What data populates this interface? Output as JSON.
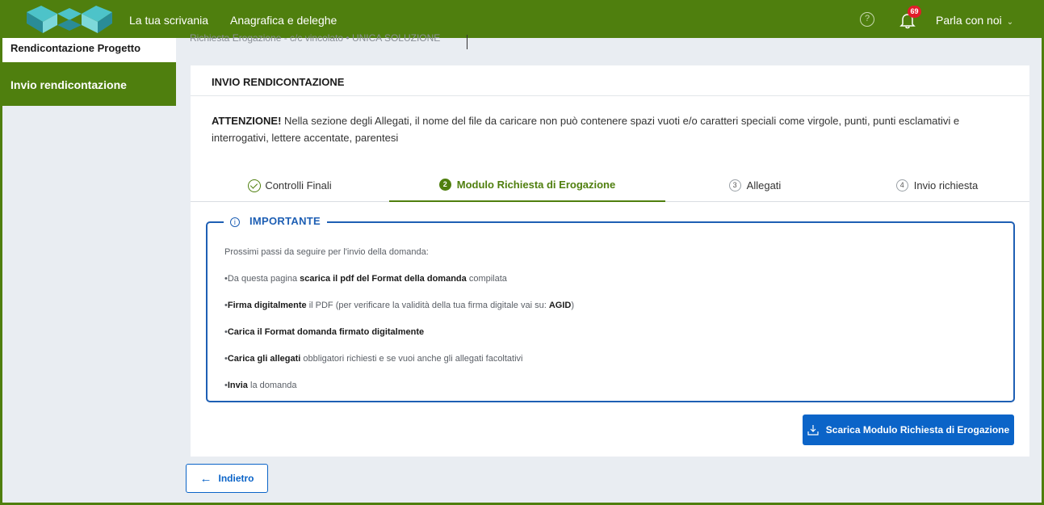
{
  "header": {
    "nav": [
      "La tua scrivania",
      "Anagrafica e deleghe"
    ],
    "help_icon": "question-circle-icon",
    "notifications_count": "69",
    "talk_label": "Parla con noi",
    "chevron": "⌄",
    "accent_color": "#4f7f0e"
  },
  "sidebar": {
    "title": "Rendicontazione Progetto",
    "active_item": "Invio rendicontazione"
  },
  "breadcrumb": {
    "text": "Richiesta Erogazione - c/c vincolato   •   UNICA SOLUZIONE"
  },
  "card": {
    "title": "INVIO RENDICONTAZIONE",
    "warning_strong": "ATTENZIONE!",
    "warning_text": " Nella sezione degli Allegati, il nome del file da caricare non può contenere spazi vuoti e/o caratteri speciali come virgole, punti, punti esclamativi e interrogativi, lettere accentate, parentesi"
  },
  "steps": [
    {
      "num": "",
      "label": "Controlli Finali",
      "state": "done"
    },
    {
      "num": "2",
      "label": "Modulo Richiesta di Erogazione",
      "state": "active"
    },
    {
      "num": "3",
      "label": "Allegati",
      "state": "todo"
    },
    {
      "num": "4",
      "label": "Invio richiesta",
      "state": "todo"
    }
  ],
  "important": {
    "title": "IMPORTANTE",
    "intro": "Prossimi passi da seguire per l'invio della domanda:",
    "items": [
      {
        "pre": "•Da questa pagina ",
        "bold": "scarica il pdf del Format della domanda",
        "post": " compilata"
      },
      {
        "pre": "•",
        "bold": "Firma digitalmente",
        "post": " il PDF (per verificare la validità della tua firma digitale vai su: ",
        "bold2": "AGID",
        "post2": ")"
      },
      {
        "pre": "•",
        "bold": "Carica il Format domanda firmato digitalmente",
        "post": ""
      },
      {
        "pre": "•",
        "bold": "Carica gli allegati",
        "post": " obbligatori richiesti e se vuoi anche gli allegati facoltativi"
      },
      {
        "pre": "•",
        "bold": "Invia",
        "post": " la domanda"
      }
    ]
  },
  "buttons": {
    "download": "Scarica Modulo Richiesta di Erogazione",
    "back": "Indietro",
    "back_arrow": "←",
    "primary_color": "#0b64c8"
  }
}
